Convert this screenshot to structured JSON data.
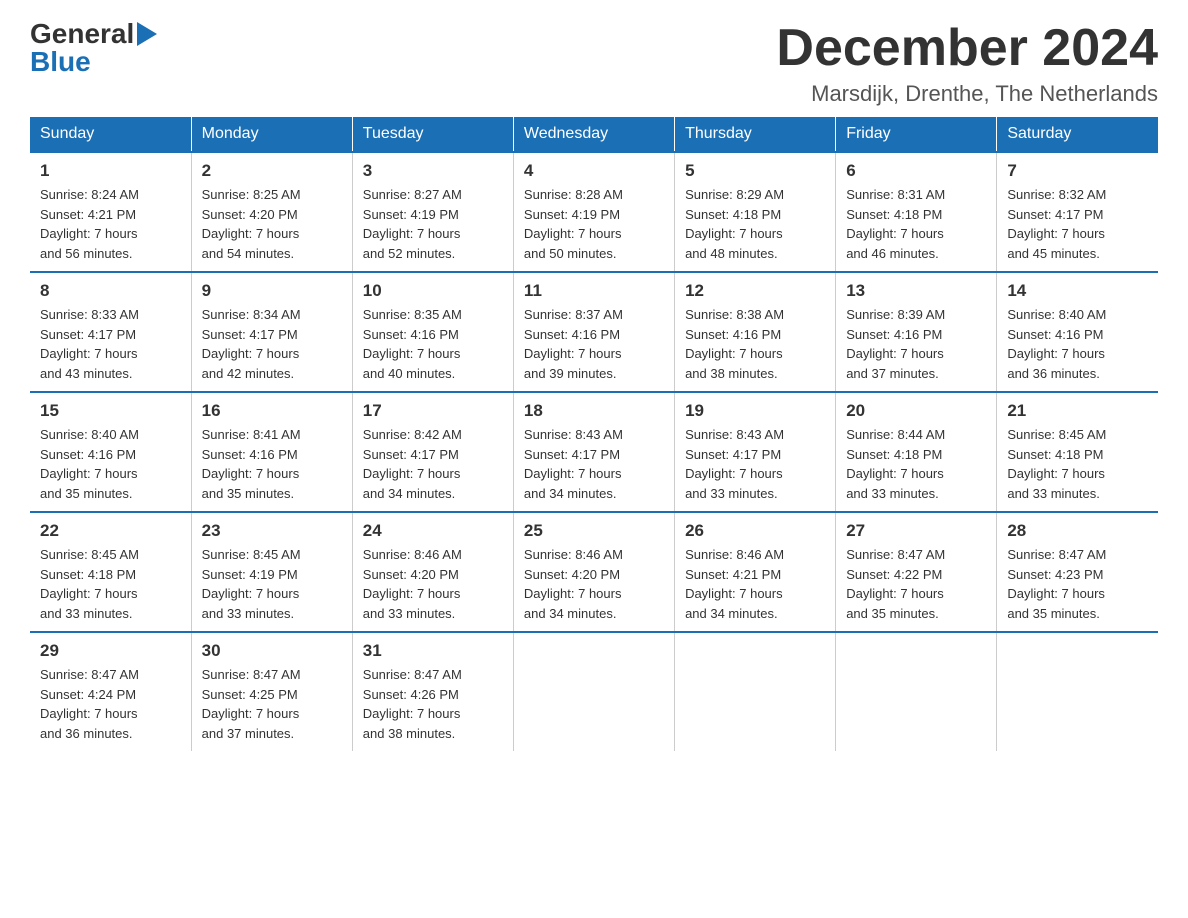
{
  "header": {
    "logo_general": "General",
    "logo_blue": "Blue",
    "month_title": "December 2024",
    "location": "Marsdijk, Drenthe, The Netherlands"
  },
  "weekdays": [
    "Sunday",
    "Monday",
    "Tuesday",
    "Wednesday",
    "Thursday",
    "Friday",
    "Saturday"
  ],
  "weeks": [
    [
      {
        "day": "1",
        "sunrise": "8:24 AM",
        "sunset": "4:21 PM",
        "daylight": "7 hours and 56 minutes."
      },
      {
        "day": "2",
        "sunrise": "8:25 AM",
        "sunset": "4:20 PM",
        "daylight": "7 hours and 54 minutes."
      },
      {
        "day": "3",
        "sunrise": "8:27 AM",
        "sunset": "4:19 PM",
        "daylight": "7 hours and 52 minutes."
      },
      {
        "day": "4",
        "sunrise": "8:28 AM",
        "sunset": "4:19 PM",
        "daylight": "7 hours and 50 minutes."
      },
      {
        "day": "5",
        "sunrise": "8:29 AM",
        "sunset": "4:18 PM",
        "daylight": "7 hours and 48 minutes."
      },
      {
        "day": "6",
        "sunrise": "8:31 AM",
        "sunset": "4:18 PM",
        "daylight": "7 hours and 46 minutes."
      },
      {
        "day": "7",
        "sunrise": "8:32 AM",
        "sunset": "4:17 PM",
        "daylight": "7 hours and 45 minutes."
      }
    ],
    [
      {
        "day": "8",
        "sunrise": "8:33 AM",
        "sunset": "4:17 PM",
        "daylight": "7 hours and 43 minutes."
      },
      {
        "day": "9",
        "sunrise": "8:34 AM",
        "sunset": "4:17 PM",
        "daylight": "7 hours and 42 minutes."
      },
      {
        "day": "10",
        "sunrise": "8:35 AM",
        "sunset": "4:16 PM",
        "daylight": "7 hours and 40 minutes."
      },
      {
        "day": "11",
        "sunrise": "8:37 AM",
        "sunset": "4:16 PM",
        "daylight": "7 hours and 39 minutes."
      },
      {
        "day": "12",
        "sunrise": "8:38 AM",
        "sunset": "4:16 PM",
        "daylight": "7 hours and 38 minutes."
      },
      {
        "day": "13",
        "sunrise": "8:39 AM",
        "sunset": "4:16 PM",
        "daylight": "7 hours and 37 minutes."
      },
      {
        "day": "14",
        "sunrise": "8:40 AM",
        "sunset": "4:16 PM",
        "daylight": "7 hours and 36 minutes."
      }
    ],
    [
      {
        "day": "15",
        "sunrise": "8:40 AM",
        "sunset": "4:16 PM",
        "daylight": "7 hours and 35 minutes."
      },
      {
        "day": "16",
        "sunrise": "8:41 AM",
        "sunset": "4:16 PM",
        "daylight": "7 hours and 35 minutes."
      },
      {
        "day": "17",
        "sunrise": "8:42 AM",
        "sunset": "4:17 PM",
        "daylight": "7 hours and 34 minutes."
      },
      {
        "day": "18",
        "sunrise": "8:43 AM",
        "sunset": "4:17 PM",
        "daylight": "7 hours and 34 minutes."
      },
      {
        "day": "19",
        "sunrise": "8:43 AM",
        "sunset": "4:17 PM",
        "daylight": "7 hours and 33 minutes."
      },
      {
        "day": "20",
        "sunrise": "8:44 AM",
        "sunset": "4:18 PM",
        "daylight": "7 hours and 33 minutes."
      },
      {
        "day": "21",
        "sunrise": "8:45 AM",
        "sunset": "4:18 PM",
        "daylight": "7 hours and 33 minutes."
      }
    ],
    [
      {
        "day": "22",
        "sunrise": "8:45 AM",
        "sunset": "4:18 PM",
        "daylight": "7 hours and 33 minutes."
      },
      {
        "day": "23",
        "sunrise": "8:45 AM",
        "sunset": "4:19 PM",
        "daylight": "7 hours and 33 minutes."
      },
      {
        "day": "24",
        "sunrise": "8:46 AM",
        "sunset": "4:20 PM",
        "daylight": "7 hours and 33 minutes."
      },
      {
        "day": "25",
        "sunrise": "8:46 AM",
        "sunset": "4:20 PM",
        "daylight": "7 hours and 34 minutes."
      },
      {
        "day": "26",
        "sunrise": "8:46 AM",
        "sunset": "4:21 PM",
        "daylight": "7 hours and 34 minutes."
      },
      {
        "day": "27",
        "sunrise": "8:47 AM",
        "sunset": "4:22 PM",
        "daylight": "7 hours and 35 minutes."
      },
      {
        "day": "28",
        "sunrise": "8:47 AM",
        "sunset": "4:23 PM",
        "daylight": "7 hours and 35 minutes."
      }
    ],
    [
      {
        "day": "29",
        "sunrise": "8:47 AM",
        "sunset": "4:24 PM",
        "daylight": "7 hours and 36 minutes."
      },
      {
        "day": "30",
        "sunrise": "8:47 AM",
        "sunset": "4:25 PM",
        "daylight": "7 hours and 37 minutes."
      },
      {
        "day": "31",
        "sunrise": "8:47 AM",
        "sunset": "4:26 PM",
        "daylight": "7 hours and 38 minutes."
      },
      null,
      null,
      null,
      null
    ]
  ],
  "labels": {
    "sunrise": "Sunrise:",
    "sunset": "Sunset:",
    "daylight": "Daylight:"
  }
}
